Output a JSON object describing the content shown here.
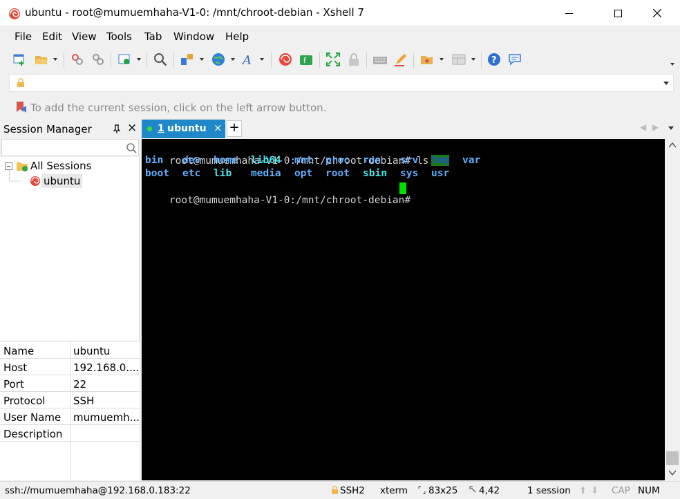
{
  "window": {
    "title": "ubuntu - root@mumuemhaha-V1-0: /mnt/chroot-debian - Xshell 7",
    "minimize_glyph": "—",
    "maximize_glyph": "☐",
    "close_glyph": "✕"
  },
  "menu": [
    "File",
    "Edit",
    "View",
    "Tools",
    "Tab",
    "Window",
    "Help"
  ],
  "toolbar": {
    "icons": [
      "new-session-icon",
      "open-folder-icon",
      "disconnect-icon",
      "reconnect-icon",
      "properties-icon",
      "find-icon",
      "transfer-icon",
      "globe-icon",
      "font-icon",
      "xshell-icon",
      "xftp-icon",
      "fullscreen-icon",
      "lock-icon",
      "keyboard-icon",
      "highlight-icon",
      "compose-icon",
      "layout-icon",
      "help-icon",
      "chat-icon"
    ]
  },
  "address_bar": {
    "value": ""
  },
  "hint": {
    "text": "To add the current session, click on the left arrow button."
  },
  "session_manager": {
    "title": "Session Manager",
    "pin_glyph": "📌",
    "close_glyph": "×",
    "search_placeholder": "",
    "tree": {
      "root": "All Sessions",
      "child": "ubuntu"
    }
  },
  "properties": [
    {
      "key": "Name",
      "value": "ubuntu"
    },
    {
      "key": "Host",
      "value": "192.168.0...."
    },
    {
      "key": "Port",
      "value": "22"
    },
    {
      "key": "Protocol",
      "value": "SSH"
    },
    {
      "key": "User Name",
      "value": "mumuemh..."
    },
    {
      "key": "Description",
      "value": ""
    }
  ],
  "tabs": [
    {
      "number": "1",
      "label": "ubuntu",
      "close": "×"
    }
  ],
  "tab_add": "+",
  "terminal": {
    "prompt": "root@mumuemhaha-V1-0:/mnt/chroot-debian#",
    "command": "ls",
    "row1": [
      "bin",
      "dev",
      "home",
      "lib64",
      "mnt",
      "proc",
      "run",
      "srv",
      "tmp",
      "var"
    ],
    "row2": [
      "boot",
      "etc",
      "lib",
      "media",
      "opt",
      "root",
      "sbin",
      "sys",
      "usr"
    ],
    "colors": {
      "dir": "#5fb0ff",
      "link": "#40e8f0",
      "tmp_bg": "#1a7a1a",
      "tmp_fg": "#1e3cff",
      "cursor": "#00e000"
    }
  },
  "status": {
    "connection": "ssh://mumuemhaha@192.168.0.183:22",
    "protocol": "SSH2",
    "term": "xterm",
    "size": "83x25",
    "position": "4,42",
    "sessions": "1 session",
    "cap": "CAP",
    "num": "NUM"
  }
}
